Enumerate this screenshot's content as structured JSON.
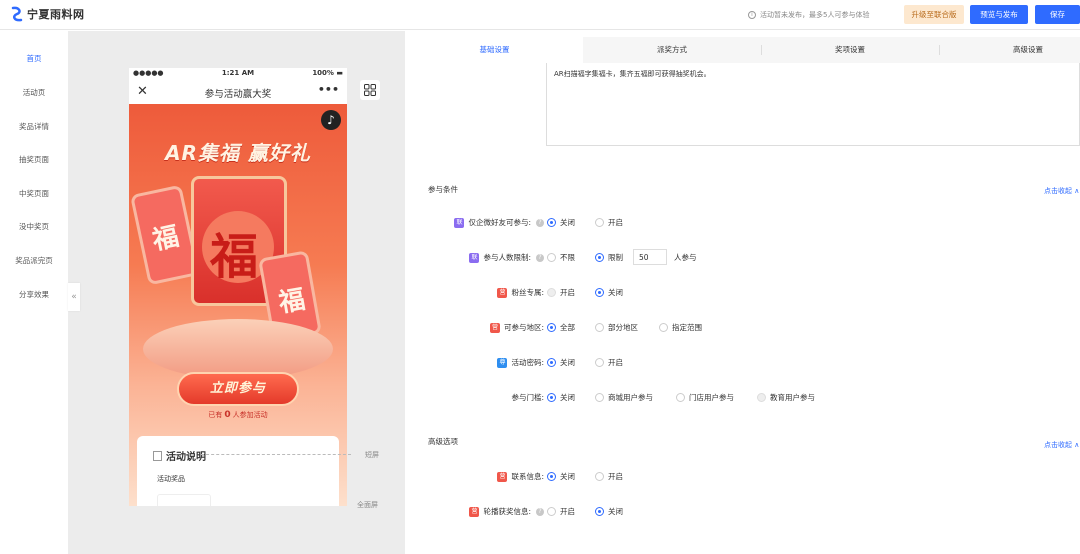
{
  "app": {
    "logo_text": "宁夏雨料网",
    "notice": "活动暂未发布，最多5人可参与体验",
    "upgrade_label": "升级至联合版",
    "preview_label": "预览与发布",
    "save_label": "保存"
  },
  "sidebar": {
    "items": [
      {
        "label": "首页",
        "active": true
      },
      {
        "label": "活动页",
        "active": false
      },
      {
        "label": "奖品详情",
        "active": false
      },
      {
        "label": "抽奖页面",
        "active": false
      },
      {
        "label": "中奖页面",
        "active": false
      },
      {
        "label": "没中奖页",
        "active": false
      },
      {
        "label": "奖品派完页",
        "active": false
      },
      {
        "label": "分享效果",
        "active": false
      }
    ],
    "collapse_glyph": "«"
  },
  "phone": {
    "signal": "●●●●●",
    "time": "1:21 AM",
    "battery": "100% ▬",
    "close_glyph": "✕",
    "title": "参与活动赢大奖",
    "more_glyph": "•••",
    "music_glyph": "♪",
    "headline": "AR集福 赢好礼",
    "fu_big": "福",
    "fu_small_left": "福",
    "fu_small_right": "福",
    "join_label": "立即参与",
    "joined_prefix": "已有",
    "joined_count": "0",
    "joined_suffix": "人参加活动",
    "desc_title": "活动说明",
    "prize_label": "活动奖品"
  },
  "preview_side": {
    "short_screen": "短屏",
    "full_screen": "全面屏"
  },
  "tabs": [
    {
      "label": "基础设置",
      "active": true
    },
    {
      "label": "派奖方式",
      "active": false
    },
    {
      "label": "奖项设置",
      "active": false
    },
    {
      "label": "高级设置",
      "active": false
    }
  ],
  "description_text": "AR扫描福字集福卡，集齐五福即可获得抽奖机会。",
  "conditions": {
    "title": "参与条件",
    "collapse_label": "点击收起 ∧",
    "rows": [
      {
        "tag": "联",
        "tag_color": "#8a6cf0",
        "label": "仅企微好友可参与:",
        "help": true,
        "options": [
          {
            "label": "关闭",
            "state": "on"
          },
          {
            "label": "开启",
            "state": "off"
          }
        ]
      },
      {
        "tag": "联",
        "tag_color": "#8a6cf0",
        "label": "参与人数限制:",
        "help": true,
        "options": [
          {
            "label": "不限",
            "state": "off"
          },
          {
            "label": "限制",
            "state": "on"
          }
        ],
        "input_value": "50",
        "unit": "人参与"
      },
      {
        "tag": "营",
        "tag_color": "#f0574a",
        "label": "粉丝专属:",
        "help": false,
        "options": [
          {
            "label": "开启",
            "state": "dis"
          },
          {
            "label": "关闭",
            "state": "on"
          }
        ]
      },
      {
        "tag": "营",
        "tag_color": "#f0574a",
        "label": "可参与地区:",
        "help": false,
        "options": [
          {
            "label": "全部",
            "state": "on"
          },
          {
            "label": "部分地区",
            "state": "off"
          },
          {
            "label": "指定范围",
            "state": "off"
          }
        ]
      },
      {
        "tag": "尊",
        "tag_color": "#2e8ef0",
        "label": "活动密码:",
        "help": false,
        "options": [
          {
            "label": "关闭",
            "state": "on"
          },
          {
            "label": "开启",
            "state": "off"
          }
        ]
      },
      {
        "tag": "",
        "tag_color": "",
        "label": "参与门槛:",
        "help": false,
        "options": [
          {
            "label": "关闭",
            "state": "on"
          },
          {
            "label": "商城用户参与",
            "state": "off"
          },
          {
            "label": "门店用户参与",
            "state": "off"
          },
          {
            "label": "教育用户参与",
            "state": "dis"
          }
        ]
      }
    ]
  },
  "advanced": {
    "title": "高级选项",
    "collapse_label": "点击收起 ∧",
    "rows": [
      {
        "tag": "营",
        "tag_color": "#f0574a",
        "label": "联系信息:",
        "help": false,
        "options": [
          {
            "label": "关闭",
            "state": "on"
          },
          {
            "label": "开启",
            "state": "off"
          }
        ]
      },
      {
        "tag": "营",
        "tag_color": "#f0574a",
        "label": "轮播获奖信息:",
        "help": true,
        "options": [
          {
            "label": "开启",
            "state": "off"
          },
          {
            "label": "关闭",
            "state": "on"
          }
        ]
      }
    ]
  }
}
